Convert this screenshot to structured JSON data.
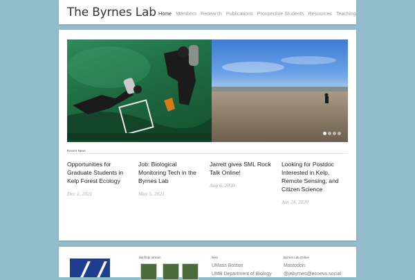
{
  "header": {
    "site_title": "The Byrnes Lab",
    "nav": [
      "Home",
      "Members",
      "Research",
      "Publications",
      "Prospective Students",
      "Resources",
      "Teaching"
    ],
    "active_nav": "Home"
  },
  "slider": {
    "slide_count": 4,
    "active_slide": 1
  },
  "recent_news": {
    "label": "Recent News",
    "posts": [
      {
        "title": "Opportunities for Graduate Students in Kelp Forest Ecology",
        "date": "Dec 1, 2021"
      },
      {
        "title": "Job: Biological Monitoring Tech in the Byrnes Lab",
        "date": "May 5, 2021"
      },
      {
        "title": "Jarrett gives SML Rock Talk Online!",
        "date": "Aug 6, 2020"
      },
      {
        "title": "Looking for Postdoc Interested in Kelp, Remote Sensing, and Citizen Science",
        "date": "Jan 24, 2020"
      }
    ]
  },
  "footer": {
    "flickr_heading": "lab flickr stream",
    "links_heading": "links",
    "links": [
      "UMass Boston",
      "UMB Department of Biology"
    ],
    "online_heading": "Byrnes Lab Online",
    "mastodon_label": "Mastodon:",
    "mastodon_handle": "@jebyrnes@ecoevo.social"
  },
  "colors": {
    "page_background": "#92bccc",
    "logo_blue": "#1e3d8f"
  }
}
